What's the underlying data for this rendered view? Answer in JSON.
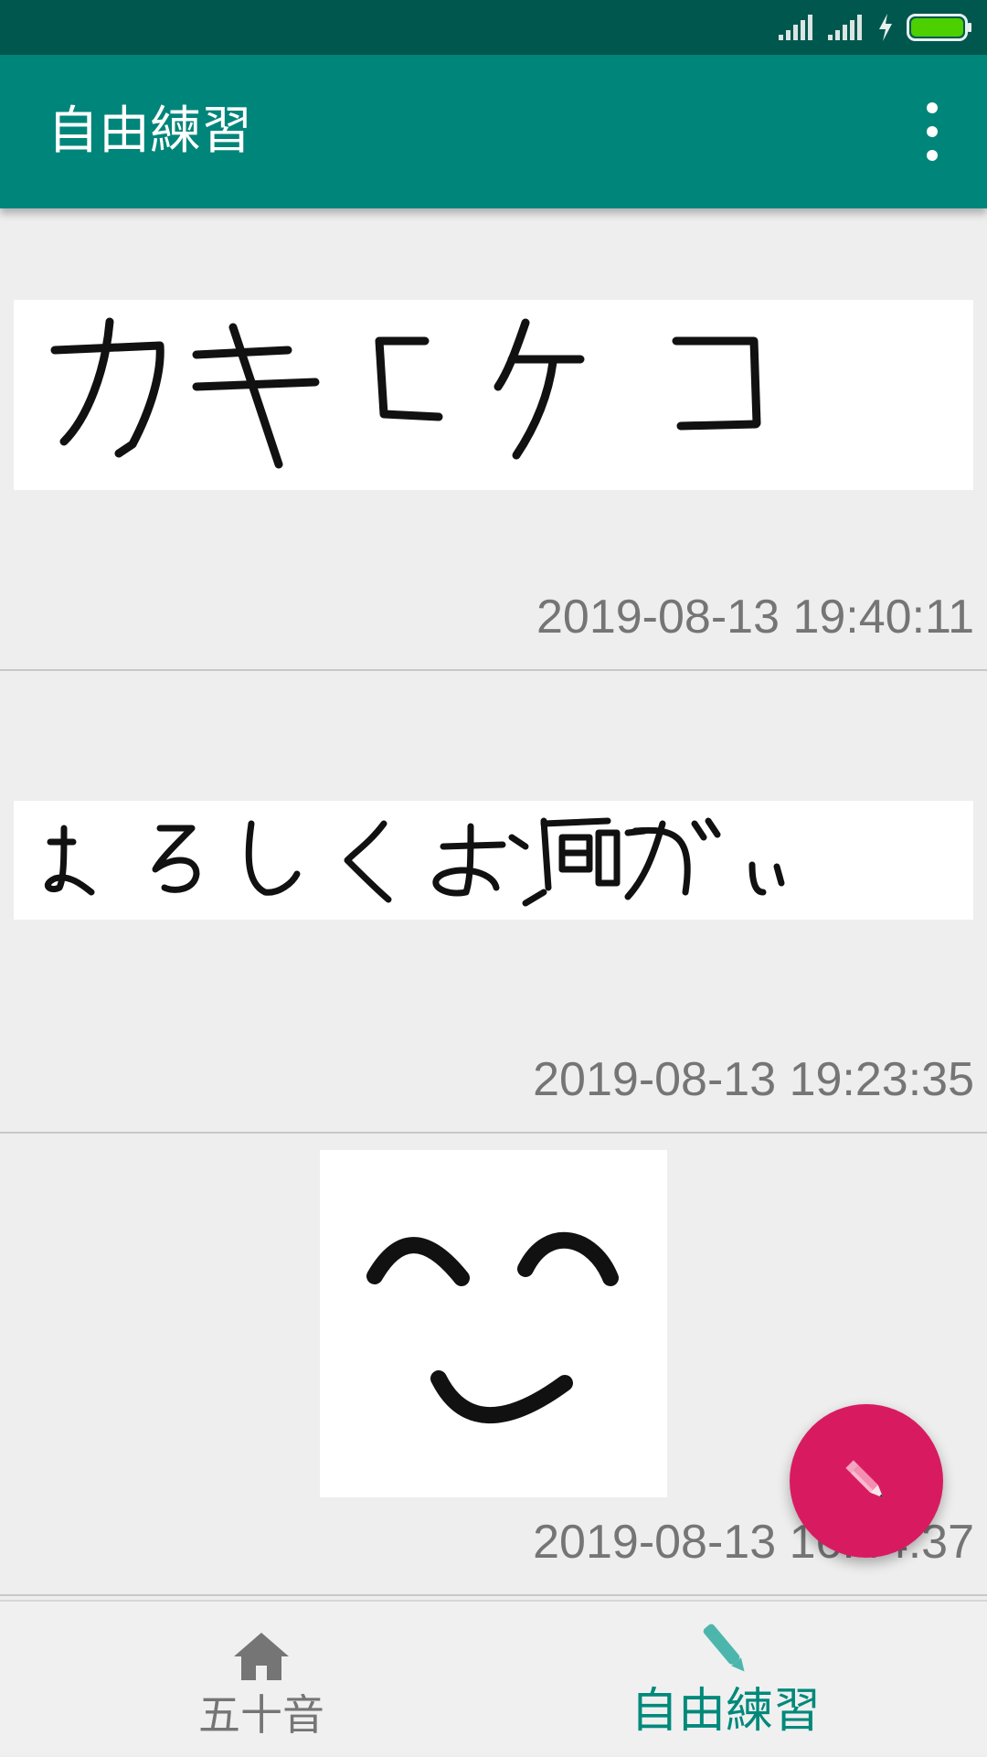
{
  "colors": {
    "status_bar": "#00574e",
    "app_bar": "#00857a",
    "fab": "#d81b60",
    "nav_active": "#00897b",
    "nav_inactive": "#757575",
    "battery": "#4cd000"
  },
  "app_bar": {
    "title": "自由練習",
    "menu_icon": "overflow-menu-icon"
  },
  "practice_list": [
    {
      "timestamp": "2019-08-13 19:40:11",
      "drawing": "handwritten-katakana-kakikeko"
    },
    {
      "timestamp": "2019-08-13 19:23:35",
      "drawing": "handwritten-yoroshiku-onegai"
    },
    {
      "timestamp": "2019-08-13 16:44:37",
      "drawing": "handwritten-smiley-face"
    }
  ],
  "fab": {
    "icon": "pencil-icon"
  },
  "bottom_nav": {
    "items": [
      {
        "label": "五十音",
        "icon": "home-icon",
        "active": false
      },
      {
        "label": "自由練習",
        "icon": "pen-icon",
        "active": true
      }
    ]
  }
}
